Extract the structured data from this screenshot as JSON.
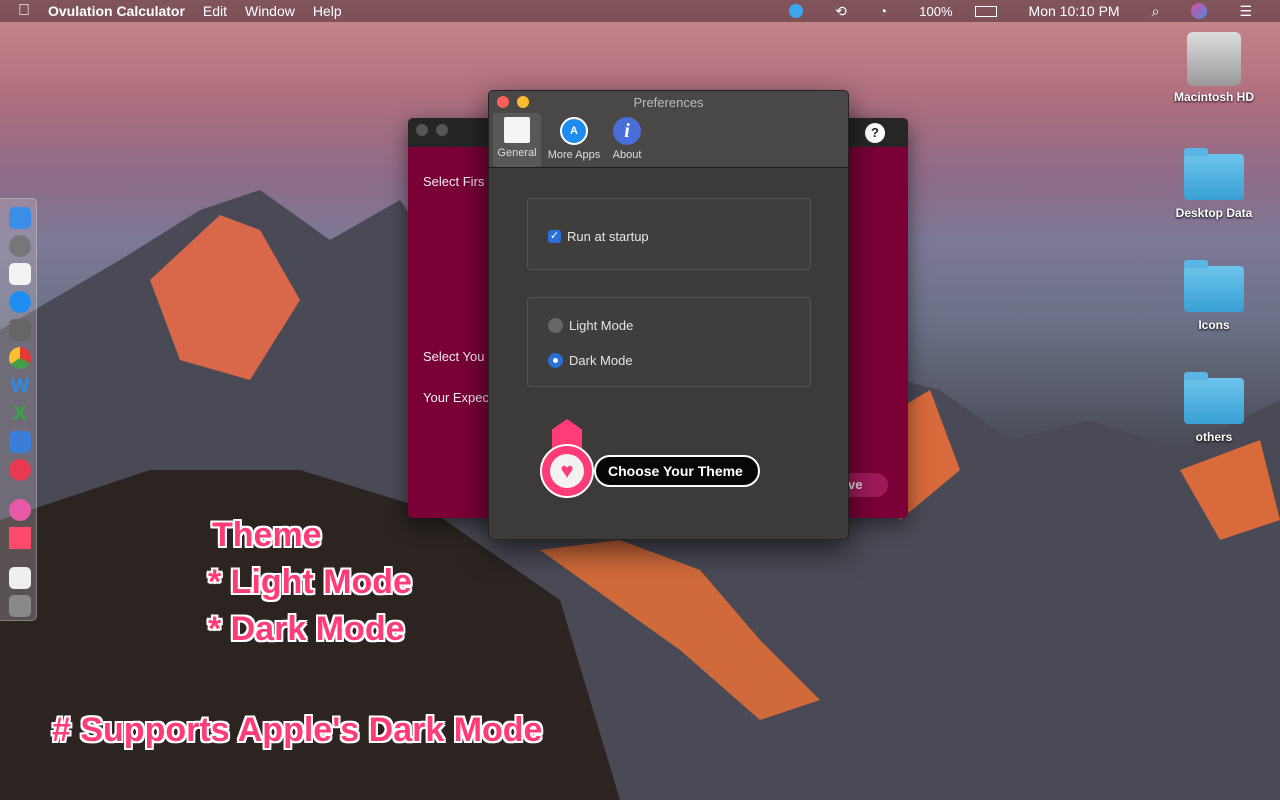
{
  "menubar": {
    "app": "Ovulation Calculator",
    "items": [
      "Edit",
      "Window",
      "Help"
    ],
    "battery": "100%",
    "clock": "Mon 10:10 PM"
  },
  "back_window": {
    "label1": "Select Firs",
    "label2": "Select You",
    "label3": "Your Expec",
    "button": "ve",
    "help": "?"
  },
  "prefs": {
    "title": "Preferences",
    "tabs": [
      {
        "label": "General",
        "icon": "switch-icon"
      },
      {
        "label": "More Apps",
        "icon": "app-store-icon"
      },
      {
        "label": "About",
        "icon": "info-icon"
      }
    ],
    "run_at_startup": {
      "label": "Run at startup",
      "checked": true
    },
    "modes": [
      {
        "label": "Light Mode",
        "selected": false
      },
      {
        "label": "Dark Mode",
        "selected": true
      }
    ],
    "theme_badge": "Choose Your Theme"
  },
  "desktop": [
    "Macintosh HD",
    "Desktop Data",
    "Icons",
    "others"
  ],
  "annotations": {
    "line1": "Theme",
    "line2": "* Light Mode",
    "line3": "* Dark Mode",
    "line4": "# Supports Apple's Dark Mode"
  },
  "colors": {
    "accent": "#2a6fd6",
    "app_crimson": "#7a0036",
    "annotation": "#ff3b78"
  }
}
